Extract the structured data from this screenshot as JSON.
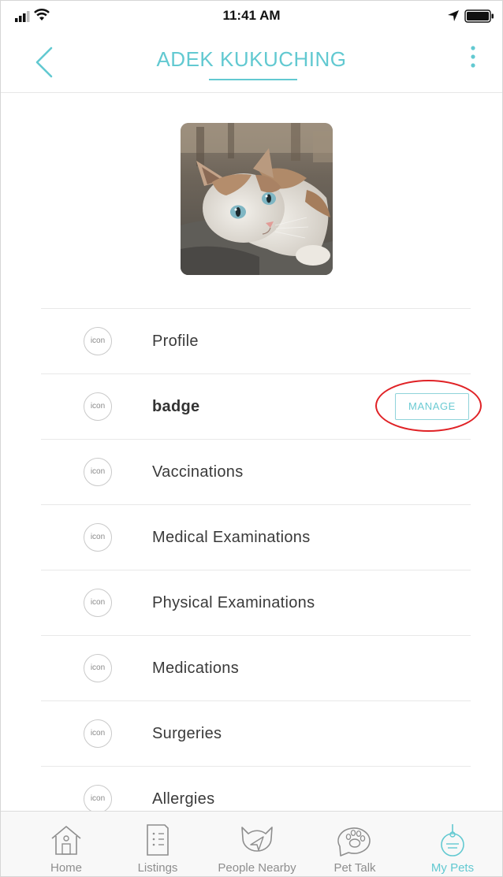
{
  "status_bar": {
    "time": "11:41 AM"
  },
  "header": {
    "title": "ADEK KUKUCHING",
    "back_icon": "chevron-left-icon",
    "menu_icon": "more-vertical-icon"
  },
  "pet_photo": {
    "subject": "cat"
  },
  "records": [
    {
      "icon_text": "icon",
      "label": "Profile"
    },
    {
      "icon_text": "icon",
      "label": "badge",
      "action": "MANAGE"
    },
    {
      "icon_text": "icon",
      "label": "Vaccinations"
    },
    {
      "icon_text": "icon",
      "label": "Medical Examinations"
    },
    {
      "icon_text": "icon",
      "label": "Physical Examinations"
    },
    {
      "icon_text": "icon",
      "label": "Medications"
    },
    {
      "icon_text": "icon",
      "label": "Surgeries"
    },
    {
      "icon_text": "icon",
      "label": "Allergies"
    }
  ],
  "tab_bar": {
    "tabs": [
      {
        "label": "Home",
        "icon": "house-icon"
      },
      {
        "label": "Listings",
        "icon": "document-icon"
      },
      {
        "label": "People Nearby",
        "icon": "cat-send-icon"
      },
      {
        "label": "Pet Talk",
        "icon": "paw-chat-icon"
      },
      {
        "label": "My Pets",
        "icon": "pet-tag-icon",
        "active": true
      }
    ]
  },
  "colors": {
    "accent": "#62c9d1",
    "annotation": "#e02226"
  }
}
